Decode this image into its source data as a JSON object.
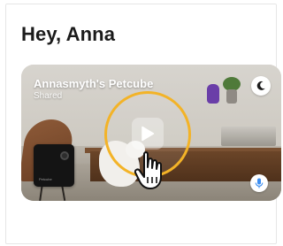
{
  "header": {
    "greeting": "Hey, Anna"
  },
  "camera_card": {
    "title": "Annasmyth's Petcube",
    "subtitle": "Shared",
    "device_label": "Petcube"
  },
  "colors": {
    "accent_ring": "#f3b327",
    "mic_icon": "#3d8ef0",
    "title_text": "#1b1b1b"
  },
  "icons": {
    "night_mode": "moon-icon",
    "microphone": "microphone-icon",
    "play": "play-icon",
    "pointer": "hand-pointer-icon"
  }
}
